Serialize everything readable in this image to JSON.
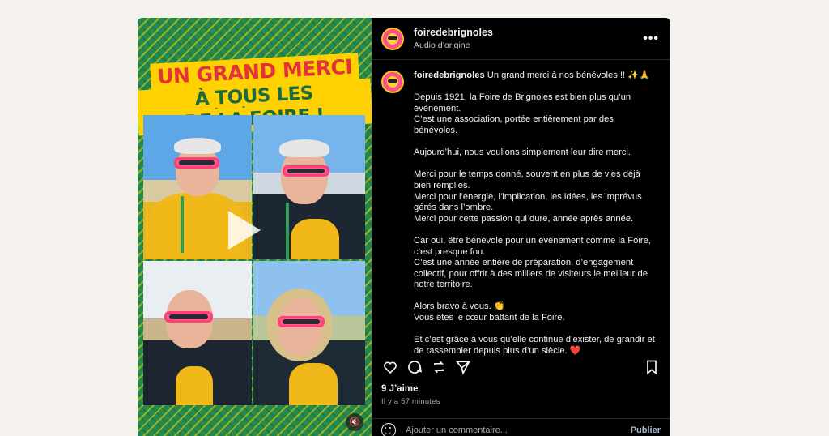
{
  "post": {
    "username": "foiredebrignoles",
    "audio": "Audio d’origine",
    "more_label": "•••",
    "media": {
      "banner_line1": "UN GRAND MERCI",
      "banner_line2": "À TOUS LES BÉNÉVOLES",
      "banner_line3": "DE LA FOIRE !",
      "mute_icon": "speaker-muted-icon"
    },
    "caption": {
      "username": "foiredebrignoles",
      "lead": "Un grand merci à nos bénévoles !! ✨🙏",
      "paragraphs": [
        "Depuis 1921, la Foire de Brignoles est bien plus qu’un événement.\nC’est une association, portée entièrement par des bénévoles.",
        "Aujourd’hui, nous voulions simplement leur dire merci.",
        "Merci pour le temps donné, souvent en plus de vies déjà bien remplies.\nMerci pour l’énergie, l’implication, les idées, les imprévus gérés dans l’ombre.\nMerci pour cette passion qui dure, année après année.",
        "Car oui, être bénévole pour un événement comme la Foire, c’est presque fou.\nC’est une année entière de préparation, d’engagement collectif, pour offrir à des milliers de visiteurs le meilleur de notre territoire.",
        "Alors bravo à vous. 👏\nVous êtes le cœur battant de la Foire.",
        "Et c’est grâce à vous qu’elle continue d’exister, de grandir et de rassembler depuis plus d’un siècle. ❤️"
      ]
    },
    "likes": "9 J’aime",
    "timestamp": "Il y a 57 minutes",
    "comment_placeholder": "Ajouter un commentaire...",
    "publish_label": "Publier",
    "colors": {
      "panel_bg": "#000000",
      "banner_yellow": "#ffd100",
      "banner_red": "#e2323a",
      "banner_green": "#1d6b3d",
      "media_green": "#248a50"
    }
  }
}
